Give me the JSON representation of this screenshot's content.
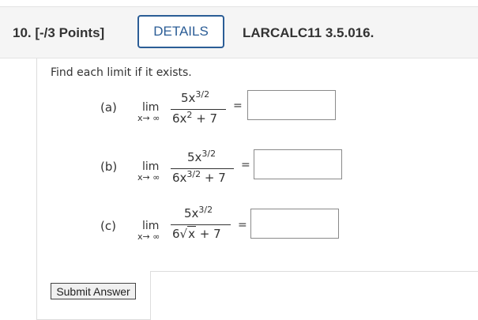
{
  "header": {
    "question_number": "10. [-/3 Points]",
    "details_label": "DETAILS",
    "reference": "LARCALC11 3.5.016."
  },
  "instructions": "Find each limit if it exists.",
  "parts": [
    {
      "label": "(a)",
      "lim": "lim",
      "sub": "x→ ∞",
      "num_base": "5x",
      "num_exp": "3/2",
      "den_base": "6x",
      "den_exp": "2",
      "den_rest": " + 7",
      "equals": "=",
      "answer": ""
    },
    {
      "label": "(b)",
      "lim": "lim",
      "sub": "x→ ∞",
      "num_base": "5x",
      "num_exp": "3/2",
      "den_base": "6x",
      "den_exp": "3/2",
      "den_rest": " + 7",
      "equals": "=",
      "answer": ""
    },
    {
      "label": "(c)",
      "lim": "lim",
      "sub": "x→ ∞",
      "num_base": "5x",
      "num_exp": "3/2",
      "den_coef": "6",
      "radical": "√",
      "radicand": "x",
      "den_rest": " + 7",
      "equals": "=",
      "answer": ""
    }
  ],
  "submit_label": "Submit Answer"
}
